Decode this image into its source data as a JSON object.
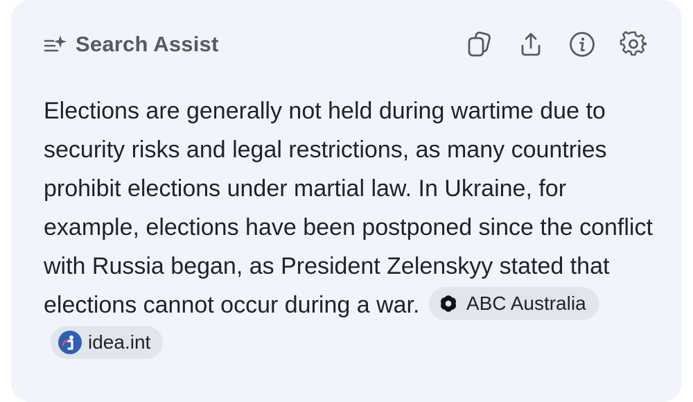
{
  "header": {
    "title": "Search Assist",
    "icons": [
      "assist-sparkle-icon",
      "copy-icon",
      "share-icon",
      "info-icon",
      "settings-gear-icon"
    ]
  },
  "answer": {
    "text": "Elections are generally not held during wartime due to security risks and legal restrictions, as many countries prohibit elections under martial law. In Ukraine, for example, elections have been postponed since the conflict with Russia began, as President Zelenskyy stated that elections cannot occur during a war."
  },
  "sources": [
    {
      "label": "ABC Australia",
      "icon": "abc-logo-icon"
    },
    {
      "label": "idea.int",
      "icon": "idea-logo-icon",
      "icon_color": "#2f5fb3"
    }
  ],
  "colors": {
    "card_background": "#f1f5fb",
    "chip_background": "#e1e6ee",
    "text": "#1f2227",
    "header_text": "#555a64"
  }
}
